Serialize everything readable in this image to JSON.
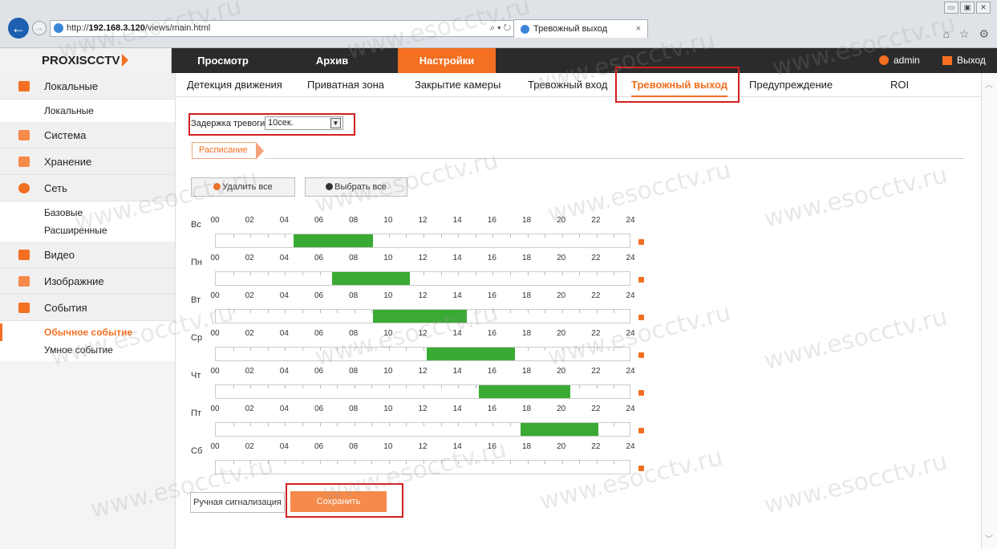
{
  "browser": {
    "url_prefix": "http://",
    "url_host": "192.168.3.120",
    "url_path": "/views/main.html",
    "address_controls": "⌕ ▾ ↻",
    "tab_title": "Тревожный выход",
    "tab_close": "×",
    "window_controls": [
      "▭",
      "▣",
      "✕"
    ],
    "toolbar_icons": "⌂ ☆ ⚙"
  },
  "header": {
    "logo": "PROXISCCTV",
    "nav": [
      "Просмотр",
      "Архив",
      "Настройки"
    ],
    "active_nav": "Настройки",
    "user": "admin",
    "logout": "Выход",
    "accent": "#f36f21"
  },
  "sidebar": {
    "sections": [
      {
        "label": "Локальные",
        "icon": "monitor-icon",
        "color": "#f36f21",
        "items": [
          "Локальные"
        ]
      },
      {
        "label": "Система",
        "icon": "system-icon",
        "color": "#f36f21",
        "items": []
      },
      {
        "label": "Хранение",
        "icon": "storage-icon",
        "color": "#f36f21",
        "items": []
      },
      {
        "label": "Сеть",
        "icon": "network-icon",
        "color": "#f36f21",
        "items": [
          "Базовые",
          "Расширенные"
        ]
      },
      {
        "label": "Видео",
        "icon": "video-icon",
        "color": "#f36f21",
        "items": []
      },
      {
        "label": "Изображние",
        "icon": "image-icon",
        "color": "#f36f21",
        "items": []
      },
      {
        "label": "События",
        "icon": "events-icon",
        "color": "#f36f21",
        "items": [
          "Обычное событие",
          "Умное событие"
        ]
      }
    ],
    "active_item": "Обычное событие"
  },
  "tabs": [
    "Детекция движения",
    "Приватная зона",
    "Закрытие камеры",
    "Тревожный вход",
    "Тревожный выход",
    "Предупреждение",
    "ROI"
  ],
  "active_tab": "Тревожный выход",
  "alarm_delay": {
    "label": "Задержка тревоги",
    "value": "10сек.",
    "arrow": "▼"
  },
  "schedule_tab": "Расписание",
  "buttons": {
    "delete_all": "Удалить все",
    "select_all": "Выбрать все",
    "manual_alarm": "Ручная сигнализация",
    "save": "Сохранить"
  },
  "hours": [
    "00",
    "02",
    "04",
    "06",
    "08",
    "10",
    "12",
    "14",
    "16",
    "18",
    "20",
    "22",
    "24"
  ],
  "schedule": [
    {
      "day": "Вс",
      "start": 4.5,
      "end": 9.1
    },
    {
      "day": "Пн",
      "start": 6.7,
      "end": 11.2
    },
    {
      "day": "Вт",
      "start": 9.1,
      "end": 14.5
    },
    {
      "day": "Ср",
      "start": 12.2,
      "end": 17.3
    },
    {
      "day": "Чт",
      "start": 15.2,
      "end": 20.5
    },
    {
      "day": "Пт",
      "start": 17.6,
      "end": 22.1
    },
    {
      "day": "Сб",
      "start": null,
      "end": null
    }
  ],
  "watermark": "www.esocctv.ru",
  "scroll_arrows": [
    "︿",
    "﹀"
  ]
}
